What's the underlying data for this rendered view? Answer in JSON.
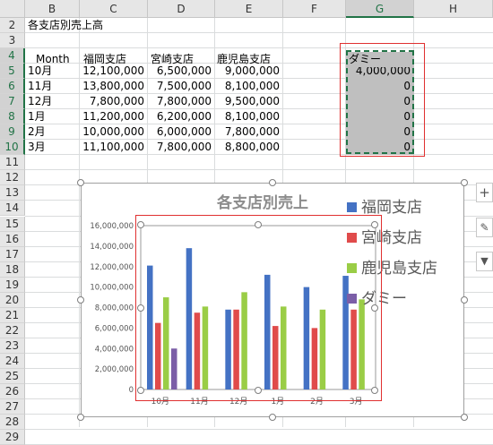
{
  "columns": [
    "B",
    "C",
    "D",
    "E",
    "F",
    "G",
    "H"
  ],
  "rows": [
    "2",
    "3",
    "4",
    "5",
    "6",
    "7",
    "8",
    "9",
    "10",
    "11",
    "12",
    "13",
    "14",
    "15",
    "16",
    "17",
    "18",
    "19",
    "20",
    "21",
    "22",
    "23",
    "24",
    "25",
    "26",
    "27",
    "28",
    "29"
  ],
  "sheet": {
    "title": "各支店別売上高",
    "headers": [
      "Month",
      "福岡支店",
      "宮崎支店",
      "鹿児島支店"
    ],
    "dummy_header": "ダミー",
    "table": [
      {
        "month": "10月",
        "fukuoka": "12,100,000",
        "miyazaki": "6,500,000",
        "kagoshima": "9,000,000",
        "dummy": "4,000,000"
      },
      {
        "month": "11月",
        "fukuoka": "13,800,000",
        "miyazaki": "7,500,000",
        "kagoshima": "8,100,000",
        "dummy": "0"
      },
      {
        "month": "12月",
        "fukuoka": "7,800,000",
        "miyazaki": "7,800,000",
        "kagoshima": "9,500,000",
        "dummy": "0"
      },
      {
        "month": "1月",
        "fukuoka": "11,200,000",
        "miyazaki": "6,200,000",
        "kagoshima": "8,100,000",
        "dummy": "0"
      },
      {
        "month": "2月",
        "fukuoka": "10,000,000",
        "miyazaki": "6,000,000",
        "kagoshima": "7,800,000",
        "dummy": "0"
      },
      {
        "month": "3月",
        "fukuoka": "11,100,000",
        "miyazaki": "7,800,000",
        "kagoshima": "8,800,000",
        "dummy": "0"
      }
    ]
  },
  "side_buttons": [
    "+",
    "✎",
    "▼"
  ],
  "chart_data": {
    "type": "bar",
    "title": "各支店別売上",
    "categories": [
      "10月",
      "11月",
      "12月",
      "1月",
      "2月",
      "3月"
    ],
    "series": [
      {
        "name": "福岡支店",
        "values": [
          12100000,
          13800000,
          7800000,
          11200000,
          10000000,
          11100000
        ],
        "color": "#4472c4"
      },
      {
        "name": "宮崎支店",
        "values": [
          6500000,
          7500000,
          7800000,
          6200000,
          6000000,
          7800000
        ],
        "color": "#e04b4b"
      },
      {
        "name": "鹿児島支店",
        "values": [
          9000000,
          8100000,
          9500000,
          8100000,
          7800000,
          8800000
        ],
        "color": "#9acd46"
      },
      {
        "name": "ダミー",
        "values": [
          4000000,
          0,
          0,
          0,
          0,
          0
        ],
        "color": "#7b5ea7"
      }
    ],
    "yticks": [
      "0",
      "2,000,000",
      "4,000,000",
      "6,000,000",
      "8,000,000",
      "10,000,000",
      "12,000,000",
      "14,000,000",
      "16,000,000"
    ],
    "ylim": [
      0,
      16000000
    ],
    "legend_position": "right"
  }
}
